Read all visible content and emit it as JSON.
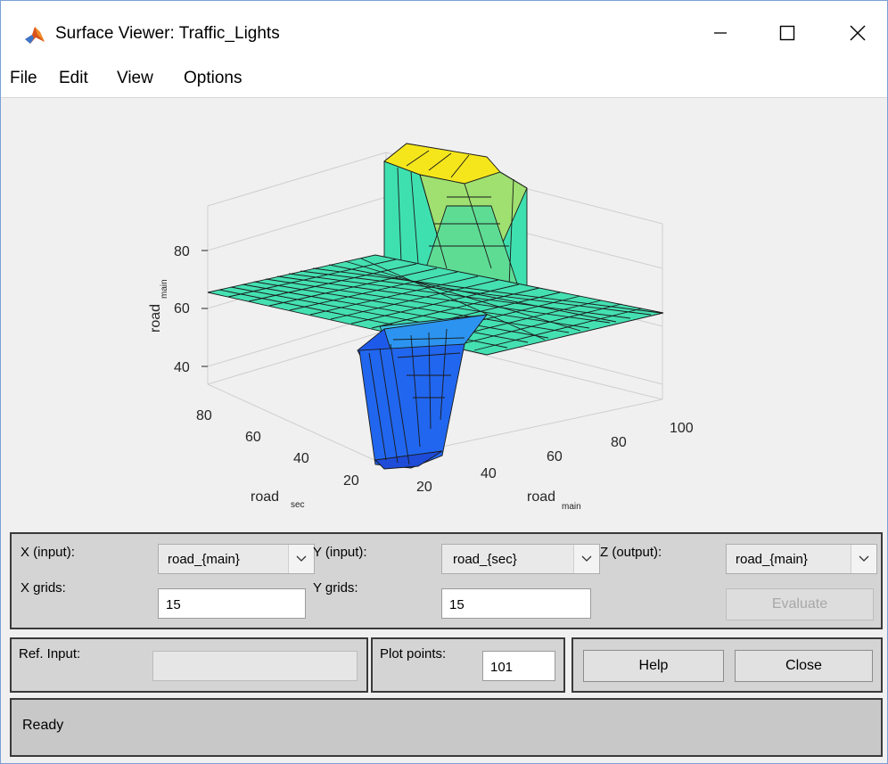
{
  "window": {
    "title": "Surface Viewer: Traffic_Lights"
  },
  "menu": [
    "File",
    "Edit",
    "View",
    "Options"
  ],
  "plot": {
    "z_ticks": [
      "80",
      "60",
      "40"
    ],
    "z_label": "road",
    "z_label_sub": "main",
    "y_ticks": [
      "80",
      "60",
      "40",
      "20"
    ],
    "y_label": "road",
    "y_label_sub": "sec",
    "x_ticks": [
      "20",
      "40",
      "60",
      "80",
      "100"
    ],
    "x_label": "road",
    "x_label_sub": "main",
    "colors": {
      "low": "#1f55e8",
      "mid": "#3fe0b4",
      "high": "#f7ea1a"
    }
  },
  "controls": {
    "x_input_label": "X (input):",
    "x_input_value": "road_{main}",
    "y_input_label": "Y (input):",
    "y_input_value": "road_{sec}",
    "z_output_label": "Z (output):",
    "z_output_value": "road_{main}",
    "x_grids_label": "X grids:",
    "x_grids_value": "15",
    "y_grids_label": "Y grids:",
    "y_grids_value": "15",
    "evaluate_label": "Evaluate",
    "ref_input_label": "Ref. Input:",
    "ref_input_value": "",
    "plot_points_label": "Plot points:",
    "plot_points_value": "101",
    "help_label": "Help",
    "close_label": "Close"
  },
  "status": "Ready"
}
